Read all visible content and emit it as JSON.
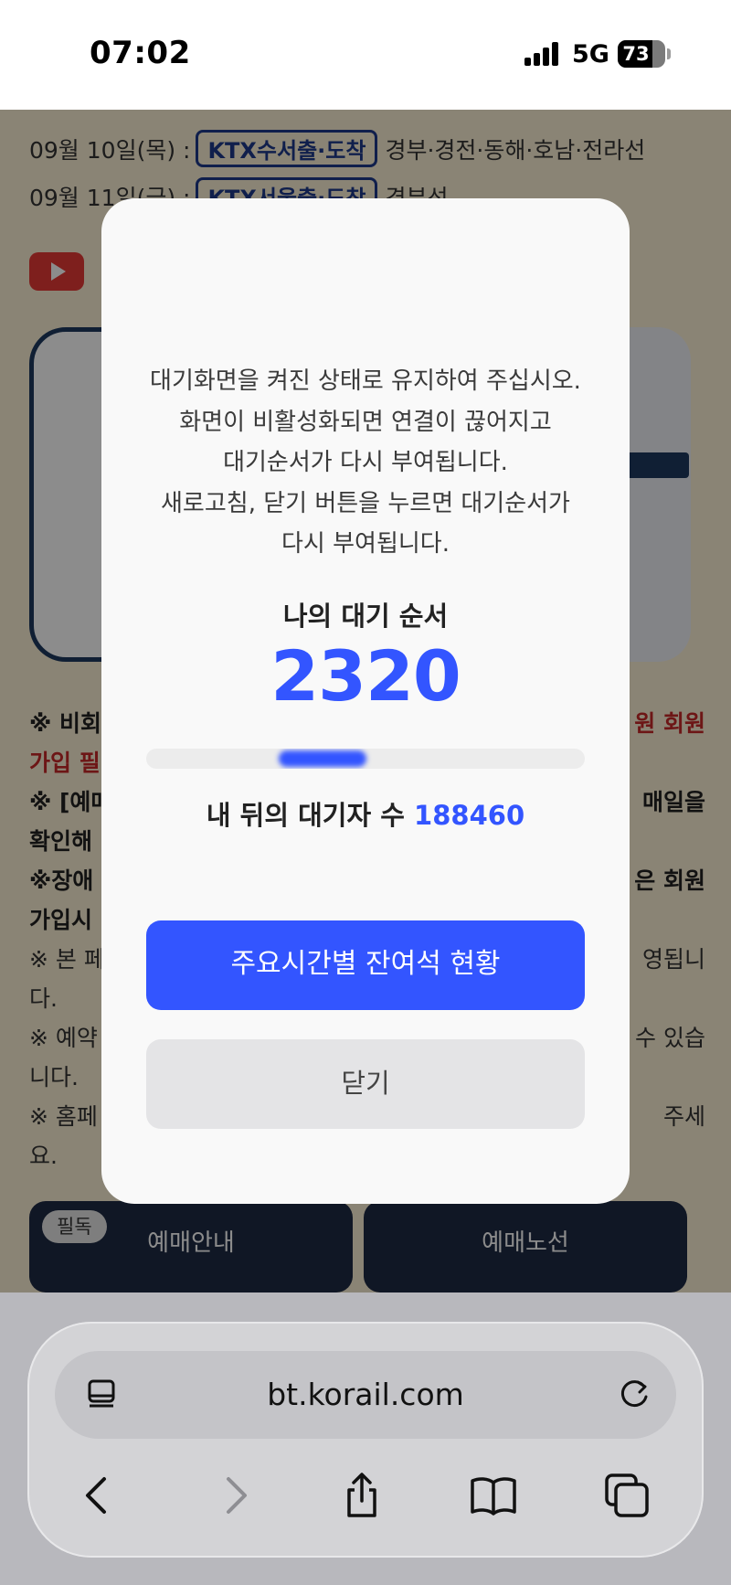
{
  "status_bar": {
    "time": "07:02",
    "network": "5G",
    "battery": "73",
    "battery_level": 0.73
  },
  "background": {
    "schedule": [
      {
        "date": "09월 10일(목) :",
        "tag": "KTX수서출·도착",
        "lines": "경부·경전·동해·호남·전라선"
      },
      {
        "date": "09월 11일(금) :",
        "tag": "KTX서울출·도착",
        "lines": "경부선"
      }
    ],
    "notes": {
      "n1_a": "※ 비회",
      "n1_red": "원 회원",
      "n1_b": "가입 필",
      "n2_a": "※ [예매",
      "n2_b": "매일을",
      "n2_c": "확인해",
      "n3_a": "※장애",
      "n3_b": "은 회원",
      "n3_c": "가입시 ",
      "n4_a": "※ 본 페",
      "n4_b": "영됩니",
      "n4_c": "다.",
      "n5_a": "※ 예약",
      "n5_b": "수 있습",
      "n5_c": "니다.",
      "n6_a": "※ 홈페",
      "n6_b": "주세",
      "n6_c": "요."
    },
    "buttons": {
      "must_read": "필독",
      "guide": "예매안내",
      "routes": "예매노선"
    }
  },
  "modal": {
    "message_lines": [
      "대기화면을 켜진 상태로 유지하여 주십시오.",
      "화면이 비활성화되면 연결이 끊어지고",
      "대기순서가 다시 부여됩니다.",
      "새로고침, 닫기 버튼을 누르면 대기순서가",
      "다시 부여됩니다."
    ],
    "queue_label": "나의 대기 순서",
    "queue_number": "2320",
    "behind_label": "내 뒤의 대기자 수",
    "behind_count": "188460",
    "primary_button": "주요시간별 잔여석 현황",
    "close_button": "닫기"
  },
  "browser": {
    "url": "bt.korail.com",
    "icons": [
      "reader-icon",
      "reload-icon",
      "back-icon",
      "forward-icon",
      "share-icon",
      "bookmarks-icon",
      "tabs-icon"
    ]
  }
}
